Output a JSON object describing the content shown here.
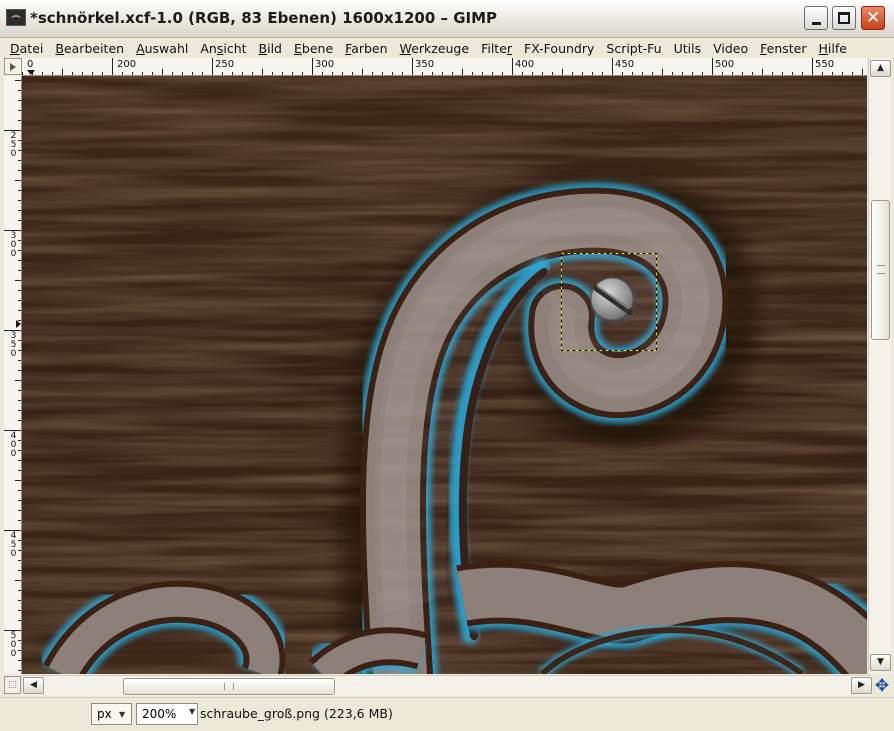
{
  "window": {
    "title": "*schnörkel.xcf-1.0 (RGB, 83 Ebenen) 1600x1200 – GIMP",
    "minimize_glyph": "",
    "close_glyph": "✕"
  },
  "menu": [
    {
      "before": "",
      "mnemonic": "D",
      "after": "atei"
    },
    {
      "before": "",
      "mnemonic": "B",
      "after": "earbeiten"
    },
    {
      "before": "",
      "mnemonic": "A",
      "after": "uswahl"
    },
    {
      "before": "An",
      "mnemonic": "s",
      "after": "icht"
    },
    {
      "before": "",
      "mnemonic": "B",
      "after": "ild"
    },
    {
      "before": "",
      "mnemonic": "E",
      "after": "bene"
    },
    {
      "before": "",
      "mnemonic": "F",
      "after": "arben"
    },
    {
      "before": "",
      "mnemonic": "W",
      "after": "erkzeuge"
    },
    {
      "before": "Filte",
      "mnemonic": "r",
      "after": ""
    },
    {
      "before": "FX-Foundry",
      "mnemonic": "",
      "after": ""
    },
    {
      "before": "Script-Fu",
      "mnemonic": "",
      "after": ""
    },
    {
      "before": "Utils",
      "mnemonic": "",
      "after": ""
    },
    {
      "before": "Video",
      "mnemonic": "",
      "after": ""
    },
    {
      "before": "",
      "mnemonic": "F",
      "after": "enster"
    },
    {
      "before": "",
      "mnemonic": "H",
      "after": "ilfe"
    }
  ],
  "rulers": {
    "horizontal_labels": [
      "0",
      "200",
      "250",
      "300",
      "350",
      "400",
      "450",
      "500",
      "550"
    ],
    "vertical_labels": [
      "250",
      "300",
      "350",
      "400",
      "450",
      "500"
    ]
  },
  "scrollbars": {
    "up_arrow": "▲",
    "down_arrow": "▼",
    "left_arrow": "◀",
    "right_arrow": "▶",
    "navigate_glyph": "✥",
    "quickmask_glyph": "⬚"
  },
  "status": {
    "unit": "px",
    "zoom": "200%",
    "dropdown_glyph": "▼",
    "message": "schraube_groß.png (223,6 MB)"
  },
  "colors": {
    "wood_dark": "#3b2619",
    "ornament_fill": "#8c7e79",
    "ornament_glow": "#2aa6d6",
    "selection_dash": "#e8e020"
  }
}
